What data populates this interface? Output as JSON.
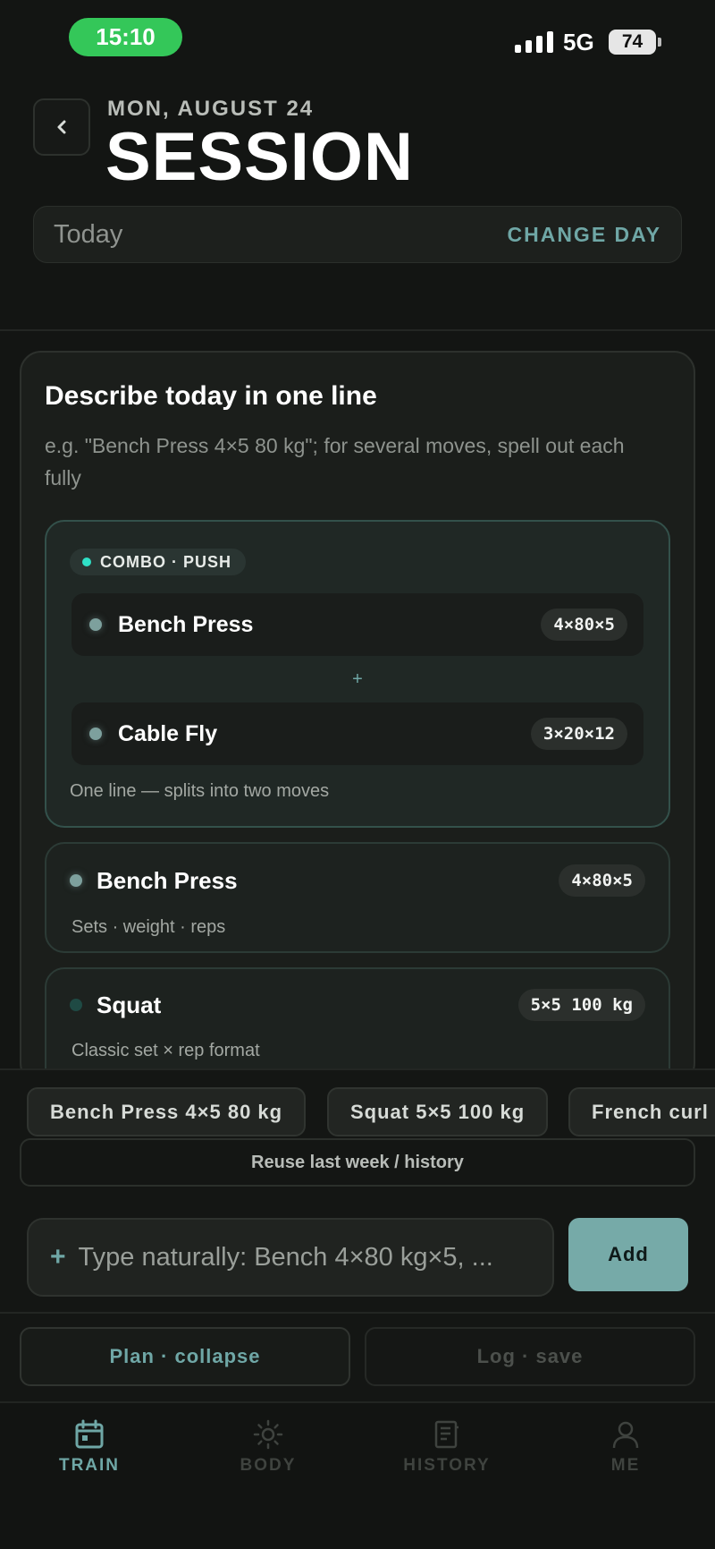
{
  "status": {
    "time": "15:10",
    "network": "5G",
    "battery": "74"
  },
  "header": {
    "date": "MON, AUGUST 24",
    "title": "SESSION"
  },
  "day_selector": {
    "value": "Today",
    "action": "CHANGE DAY"
  },
  "card": {
    "title": "Describe today in one line",
    "subtitle": "e.g. \"Bench Press 4×5 80 kg\"; for several moves, spell out each fully"
  },
  "combo": {
    "tag": "COMBO · PUSH",
    "moves": [
      {
        "name": "Bench Press",
        "scheme": "4×80×5"
      },
      {
        "name": "Cable Fly",
        "scheme": "3×20×12"
      }
    ],
    "separator": "+",
    "note": "One line — splits into two moves"
  },
  "examples": [
    {
      "name": "Bench Press",
      "scheme": "4×80×5",
      "desc": "Sets · weight · reps",
      "dot_color": "#7da09d"
    },
    {
      "name": "Squat",
      "scheme": "5×5 100 kg",
      "desc": "Classic set × rep format",
      "dot_color": "#1f4a44"
    }
  ],
  "suggestions": [
    "Bench Press 4×5 80 kg",
    "Squat 5×5 100 kg",
    "French curl"
  ],
  "reuse_label": "Reuse last week / history",
  "input": {
    "placeholder": "Type naturally: Bench 4×80 kg×5, ...",
    "add_label": "Add"
  },
  "modes": {
    "plan": "Plan · collapse",
    "log": "Log · save"
  },
  "tabs": [
    {
      "label": "TRAIN",
      "icon": "calendar-icon",
      "active": true
    },
    {
      "label": "BODY",
      "icon": "sun-icon",
      "active": false
    },
    {
      "label": "HISTORY",
      "icon": "book-icon",
      "active": false
    },
    {
      "label": "ME",
      "icon": "person-icon",
      "active": false
    }
  ],
  "colors": {
    "accent": "#6fa7a6",
    "add_button": "#76aaa8",
    "status_pill": "#34c759"
  }
}
